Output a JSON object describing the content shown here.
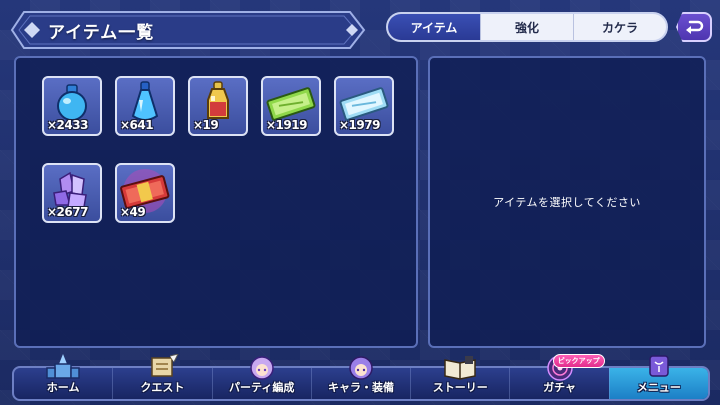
{
  "title": "アイテム一覧",
  "tabs": [
    {
      "label": "アイテム",
      "active": true
    },
    {
      "label": "強化",
      "active": false
    },
    {
      "label": "カケラ",
      "active": false
    }
  ],
  "items": [
    {
      "icon": "blue-potion-icon",
      "count": "×2433"
    },
    {
      "icon": "blue-flask-icon",
      "count": "×641"
    },
    {
      "icon": "gold-elixir-icon",
      "count": "×19"
    },
    {
      "icon": "green-ticket-icon",
      "count": "×1919"
    },
    {
      "icon": "light-blue-ticket-icon",
      "count": "×1979"
    },
    {
      "icon": "purple-crystal-icon",
      "count": "×2677"
    },
    {
      "icon": "red-ticket-icon",
      "count": "×49"
    }
  ],
  "detail_message": "アイテムを選択してください",
  "nav": [
    {
      "label": "ホーム",
      "icon": "castle-icon"
    },
    {
      "label": "クエスト",
      "icon": "scroll-icon"
    },
    {
      "label": "パーティ編成",
      "icon": "character-icon"
    },
    {
      "label": "キャラ・装備",
      "icon": "character-icon"
    },
    {
      "label": "ストーリー",
      "icon": "book-icon"
    },
    {
      "label": "ガチャ",
      "icon": "gacha-icon",
      "badge": "ピックアップ"
    },
    {
      "label": "メニュー",
      "icon": "menu-icon",
      "active": true
    }
  ],
  "colors": {
    "background": "#1e2f6e",
    "panel": "#0e1c52",
    "tab_active": "#2a3a95",
    "nav_active": "#1c7fc6",
    "badge": "#e22d8c"
  }
}
